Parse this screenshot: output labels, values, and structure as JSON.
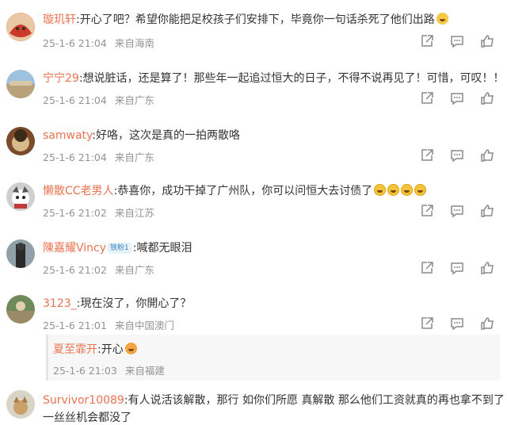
{
  "comments": [
    {
      "username": "璇玑轩",
      "text": ":开心了吧？希望你能把足校孩子们安排下，毕竟你一句话杀死了他们出路",
      "time": "25-1-6 21:04",
      "location": "来自海南",
      "emoji": "emoji-face"
    },
    {
      "username": "宁宁29",
      "text": ":想说脏话，还是算了！那些年一起追过恒大的日子，不得不说再见了！可惜，可叹！！",
      "time": "25-1-6 21:04",
      "location": "来自广东"
    },
    {
      "username": "samwaty",
      "text": ":好咯，这次是真的一拍两散咯",
      "time": "25-1-6 21:04",
      "location": "来自广东"
    },
    {
      "username": "懒散CC老男人",
      "text": ":恭喜你，成功干掉了广州队，你可以问恒大去讨债了",
      "time": "25-1-6 21:02",
      "location": "来自江苏",
      "emoji": "laugh-cry-emoji-x4"
    },
    {
      "username": "陳嘉耀Vincy",
      "badge": "铁粉1",
      "text": ":喊都无眼泪",
      "time": "25-1-6 21:02",
      "location": "来自广东"
    },
    {
      "username": "3123_",
      "text": ":現在沒了，你開心了？",
      "time": "25-1-6 21:01",
      "location": "来自中国澳门",
      "reply": {
        "username": "夏至霏开",
        "text": ":开心",
        "time": "25-1-6 21:03",
        "location": "来自福建"
      }
    },
    {
      "username": "Survivor10089",
      "text": ":有人说活该解散，那行 如你们所愿 真解散 那么他们工资就真的再也拿不到了",
      "text2": "一丝丝机会都没了"
    }
  ],
  "icons": [
    "share-icon",
    "comment-icon",
    "like-icon"
  ],
  "colors": {
    "username": "#eb7350",
    "meta": "#939393",
    "text": "#333333",
    "icon": "#8a8a8a"
  }
}
